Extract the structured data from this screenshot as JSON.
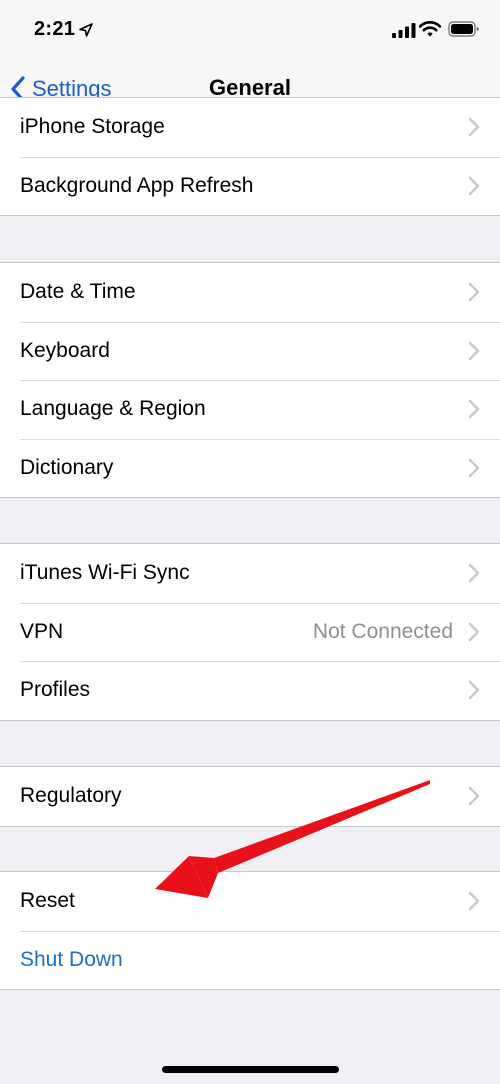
{
  "status_bar": {
    "time": "2:21"
  },
  "nav": {
    "back_label": "Settings",
    "title": "General"
  },
  "groups": [
    {
      "rows": [
        {
          "label": "iPhone Storage"
        },
        {
          "label": "Background App Refresh"
        }
      ]
    },
    {
      "rows": [
        {
          "label": "Date & Time"
        },
        {
          "label": "Keyboard"
        },
        {
          "label": "Language & Region"
        },
        {
          "label": "Dictionary"
        }
      ]
    },
    {
      "rows": [
        {
          "label": "iTunes Wi-Fi Sync"
        },
        {
          "label": "VPN",
          "detail": "Not Connected"
        },
        {
          "label": "Profiles"
        }
      ]
    },
    {
      "rows": [
        {
          "label": "Regulatory"
        }
      ]
    },
    {
      "rows": [
        {
          "label": "Reset"
        },
        {
          "label": "Shut Down"
        }
      ]
    }
  ],
  "colors": {
    "accent_blue": "#1a6fc9",
    "annotation_arrow": "#e8111a",
    "background": "#efeff4"
  }
}
